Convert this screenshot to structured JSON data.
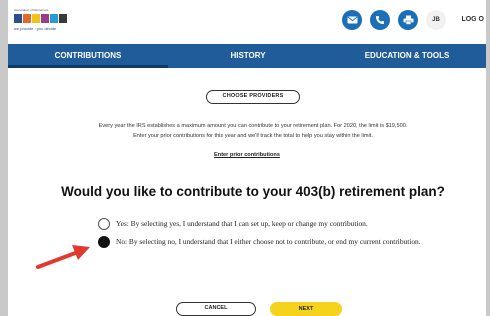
{
  "header": {
    "logo_small_text": "Association of Retirement",
    "logo_tagline": "we provide · you decide",
    "logo_colors": [
      "#2a4f8f",
      "#e06a2a",
      "#f2c21b",
      "#9b3b8e",
      "#2a9ad4",
      "#3a3a3a"
    ],
    "icons": [
      "mail-icon",
      "phone-icon",
      "print-icon"
    ],
    "user_initials": "JB",
    "logout_label": "LOG O"
  },
  "nav": {
    "tabs": [
      {
        "label": "CONTRIBUTIONS",
        "active": true
      },
      {
        "label": "HISTORY",
        "active": false
      },
      {
        "label": "EDUCATION & TOOLS",
        "active": false
      }
    ]
  },
  "main": {
    "choose_providers_label": "CHOOSE PROVIDERS",
    "intro_line1": "Every year the IRS establishes a maximum amount you can contribute to your retirement plan. For 2020, the limit is $19,500.",
    "intro_line2": "Enter your prior contributions for this year and we'll track the total to help you stay within the limit.",
    "prior_link": "Enter prior contributions",
    "question": "Would you like to contribute to your 403(b) retirement plan?",
    "options": [
      {
        "text": "Yes: By selecting yes, I understand that I can set up, keep or change my contribution.",
        "selected": false
      },
      {
        "text": "No: By selecting no, I understand that I either choose not to contribute, or end my current contribution.",
        "selected": true
      }
    ],
    "cancel_label": "CANCEL",
    "next_label": "NEXT"
  },
  "colors": {
    "nav_blue": "#1f5c99",
    "icon_blue": "#1a6fb8",
    "next_yellow": "#f5d21c",
    "arrow_red": "#e03a2e"
  }
}
